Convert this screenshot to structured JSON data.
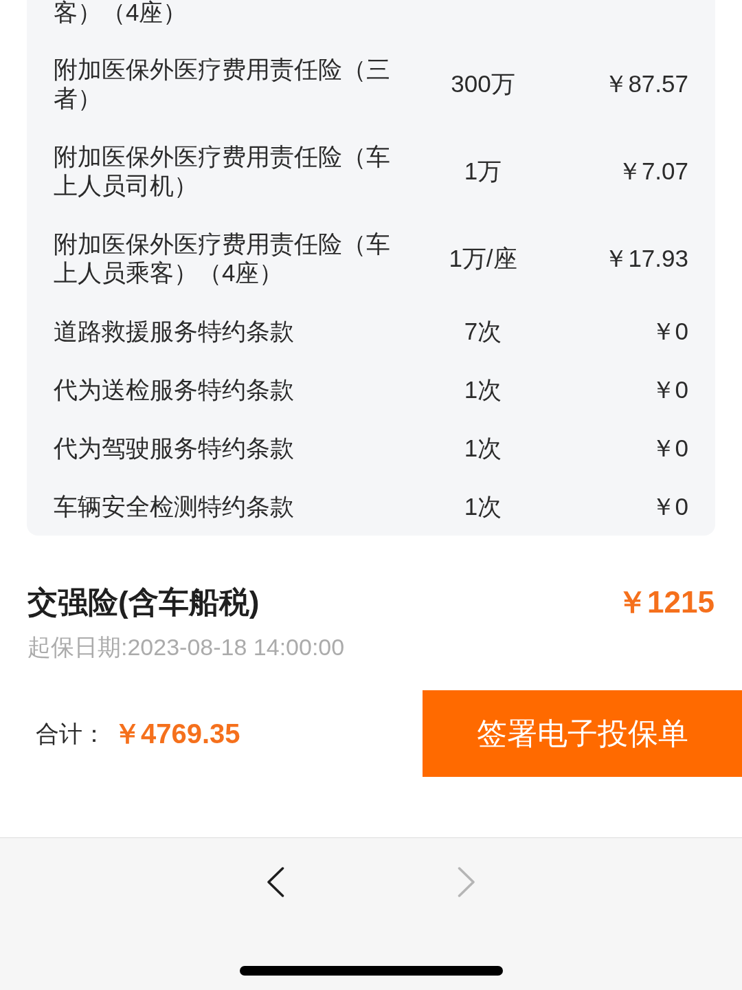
{
  "coverage_table": {
    "rows": [
      {
        "item": "客）（4座）"
      },
      {
        "item": "附加医保外医疗费用责任险（三者）",
        "amount": "300万",
        "premium": "￥87.57"
      },
      {
        "item": "附加医保外医疗费用责任险（车上人员司机）",
        "amount": "1万",
        "premium": "￥7.07"
      },
      {
        "item": "附加医保外医疗费用责任险（车上人员乘客）（4座）",
        "amount": "1万/座",
        "premium": "￥17.93"
      },
      {
        "item": "道路救援服务特约条款",
        "amount": "7次",
        "premium": "￥0"
      },
      {
        "item": "代为送检服务特约条款",
        "amount": "1次",
        "premium": "￥0"
      },
      {
        "item": "代为驾驶服务特约条款",
        "amount": "1次",
        "premium": "￥0"
      },
      {
        "item": "车辆安全检测特约条款",
        "amount": "1次",
        "premium": "￥0"
      }
    ]
  },
  "compulsory_insurance": {
    "title": "交强险(含车船税)",
    "price": "￥1215",
    "start_date": "起保日期:2023-08-18 14:00:00"
  },
  "footer": {
    "total_label": "合计：",
    "total_value": "￥4769.35",
    "submit_button": "签署电子投保单"
  },
  "browser_toolbar": {
    "buttons": [
      {
        "kind": "back",
        "disabled": false
      },
      {
        "kind": "forward",
        "disabled": true
      }
    ]
  }
}
